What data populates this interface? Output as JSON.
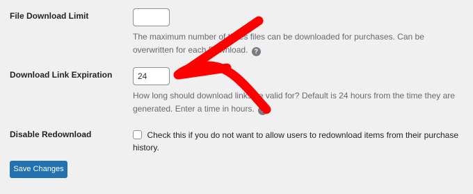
{
  "settings": {
    "file_download_limit": {
      "label": "File Download Limit",
      "value": "",
      "description": "The maximum number of times files can be downloaded for purchases. Can be overwritten for each Download."
    },
    "download_link_expiration": {
      "label": "Download Link Expiration",
      "value": "24",
      "description": "How long should download links be valid for? Default is 24 hours from the time they are generated. Enter a time in hours."
    },
    "disable_redownload": {
      "label": "Disable Redownload",
      "checked": false,
      "checkbox_label": "Check this if you do not want to allow users to redownload items from their purchase history."
    }
  },
  "help_glyph": "?",
  "save_button_label": "Save Changes",
  "annotation": {
    "color": "#ff0000",
    "icon": "red-hand-drawn-arrow"
  },
  "colors": {
    "background": "#f0f0f1",
    "primary_button": "#2271b1",
    "help_icon": "#787c82"
  }
}
